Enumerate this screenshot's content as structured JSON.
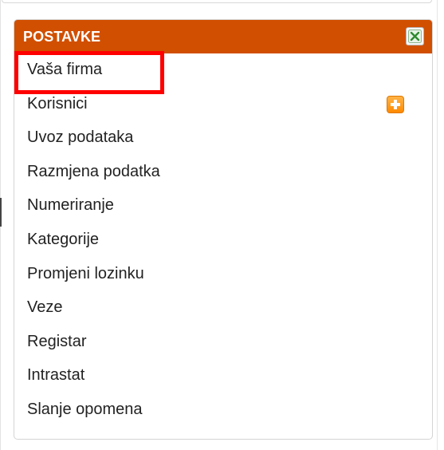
{
  "panel": {
    "title": "POSTAVKE",
    "close_icon": "close-x-icon",
    "header_color": "#d14f00",
    "items": [
      {
        "label": "Vaša firma"
      },
      {
        "label": "Korisnici",
        "action_icon": "plus-icon"
      },
      {
        "label": "Uvoz podataka"
      },
      {
        "label": "Razmjena podatka"
      },
      {
        "label": "Numeriranje"
      },
      {
        "label": "Kategorije"
      },
      {
        "label": "Promjeni lozinku"
      },
      {
        "label": "Veze"
      },
      {
        "label": "Registar"
      },
      {
        "label": "Intrastat"
      },
      {
        "label": "Slanje opomena"
      }
    ]
  },
  "highlight": {
    "target": "Vaša firma",
    "color": "#ff0000"
  }
}
